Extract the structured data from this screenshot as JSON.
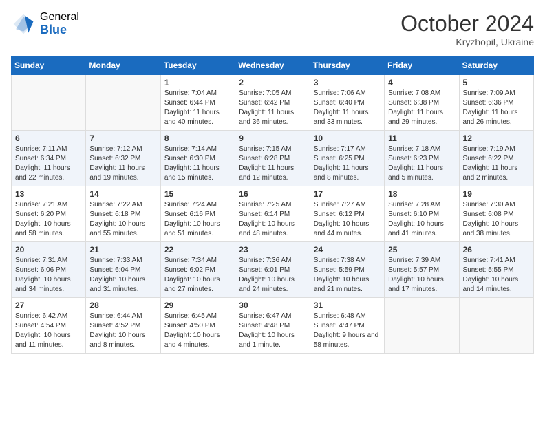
{
  "header": {
    "logo_general": "General",
    "logo_blue": "Blue",
    "month_year": "October 2024",
    "location": "Kryzhopil, Ukraine"
  },
  "days_of_week": [
    "Sunday",
    "Monday",
    "Tuesday",
    "Wednesday",
    "Thursday",
    "Friday",
    "Saturday"
  ],
  "weeks": [
    [
      {
        "day": "",
        "info": ""
      },
      {
        "day": "",
        "info": ""
      },
      {
        "day": "1",
        "info": "Sunrise: 7:04 AM\nSunset: 6:44 PM\nDaylight: 11 hours and 40 minutes."
      },
      {
        "day": "2",
        "info": "Sunrise: 7:05 AM\nSunset: 6:42 PM\nDaylight: 11 hours and 36 minutes."
      },
      {
        "day": "3",
        "info": "Sunrise: 7:06 AM\nSunset: 6:40 PM\nDaylight: 11 hours and 33 minutes."
      },
      {
        "day": "4",
        "info": "Sunrise: 7:08 AM\nSunset: 6:38 PM\nDaylight: 11 hours and 29 minutes."
      },
      {
        "day": "5",
        "info": "Sunrise: 7:09 AM\nSunset: 6:36 PM\nDaylight: 11 hours and 26 minutes."
      }
    ],
    [
      {
        "day": "6",
        "info": "Sunrise: 7:11 AM\nSunset: 6:34 PM\nDaylight: 11 hours and 22 minutes."
      },
      {
        "day": "7",
        "info": "Sunrise: 7:12 AM\nSunset: 6:32 PM\nDaylight: 11 hours and 19 minutes."
      },
      {
        "day": "8",
        "info": "Sunrise: 7:14 AM\nSunset: 6:30 PM\nDaylight: 11 hours and 15 minutes."
      },
      {
        "day": "9",
        "info": "Sunrise: 7:15 AM\nSunset: 6:28 PM\nDaylight: 11 hours and 12 minutes."
      },
      {
        "day": "10",
        "info": "Sunrise: 7:17 AM\nSunset: 6:25 PM\nDaylight: 11 hours and 8 minutes."
      },
      {
        "day": "11",
        "info": "Sunrise: 7:18 AM\nSunset: 6:23 PM\nDaylight: 11 hours and 5 minutes."
      },
      {
        "day": "12",
        "info": "Sunrise: 7:19 AM\nSunset: 6:22 PM\nDaylight: 11 hours and 2 minutes."
      }
    ],
    [
      {
        "day": "13",
        "info": "Sunrise: 7:21 AM\nSunset: 6:20 PM\nDaylight: 10 hours and 58 minutes."
      },
      {
        "day": "14",
        "info": "Sunrise: 7:22 AM\nSunset: 6:18 PM\nDaylight: 10 hours and 55 minutes."
      },
      {
        "day": "15",
        "info": "Sunrise: 7:24 AM\nSunset: 6:16 PM\nDaylight: 10 hours and 51 minutes."
      },
      {
        "day": "16",
        "info": "Sunrise: 7:25 AM\nSunset: 6:14 PM\nDaylight: 10 hours and 48 minutes."
      },
      {
        "day": "17",
        "info": "Sunrise: 7:27 AM\nSunset: 6:12 PM\nDaylight: 10 hours and 44 minutes."
      },
      {
        "day": "18",
        "info": "Sunrise: 7:28 AM\nSunset: 6:10 PM\nDaylight: 10 hours and 41 minutes."
      },
      {
        "day": "19",
        "info": "Sunrise: 7:30 AM\nSunset: 6:08 PM\nDaylight: 10 hours and 38 minutes."
      }
    ],
    [
      {
        "day": "20",
        "info": "Sunrise: 7:31 AM\nSunset: 6:06 PM\nDaylight: 10 hours and 34 minutes."
      },
      {
        "day": "21",
        "info": "Sunrise: 7:33 AM\nSunset: 6:04 PM\nDaylight: 10 hours and 31 minutes."
      },
      {
        "day": "22",
        "info": "Sunrise: 7:34 AM\nSunset: 6:02 PM\nDaylight: 10 hours and 27 minutes."
      },
      {
        "day": "23",
        "info": "Sunrise: 7:36 AM\nSunset: 6:01 PM\nDaylight: 10 hours and 24 minutes."
      },
      {
        "day": "24",
        "info": "Sunrise: 7:38 AM\nSunset: 5:59 PM\nDaylight: 10 hours and 21 minutes."
      },
      {
        "day": "25",
        "info": "Sunrise: 7:39 AM\nSunset: 5:57 PM\nDaylight: 10 hours and 17 minutes."
      },
      {
        "day": "26",
        "info": "Sunrise: 7:41 AM\nSunset: 5:55 PM\nDaylight: 10 hours and 14 minutes."
      }
    ],
    [
      {
        "day": "27",
        "info": "Sunrise: 6:42 AM\nSunset: 4:54 PM\nDaylight: 10 hours and 11 minutes."
      },
      {
        "day": "28",
        "info": "Sunrise: 6:44 AM\nSunset: 4:52 PM\nDaylight: 10 hours and 8 minutes."
      },
      {
        "day": "29",
        "info": "Sunrise: 6:45 AM\nSunset: 4:50 PM\nDaylight: 10 hours and 4 minutes."
      },
      {
        "day": "30",
        "info": "Sunrise: 6:47 AM\nSunset: 4:48 PM\nDaylight: 10 hours and 1 minute."
      },
      {
        "day": "31",
        "info": "Sunrise: 6:48 AM\nSunset: 4:47 PM\nDaylight: 9 hours and 58 minutes."
      },
      {
        "day": "",
        "info": ""
      },
      {
        "day": "",
        "info": ""
      }
    ]
  ]
}
